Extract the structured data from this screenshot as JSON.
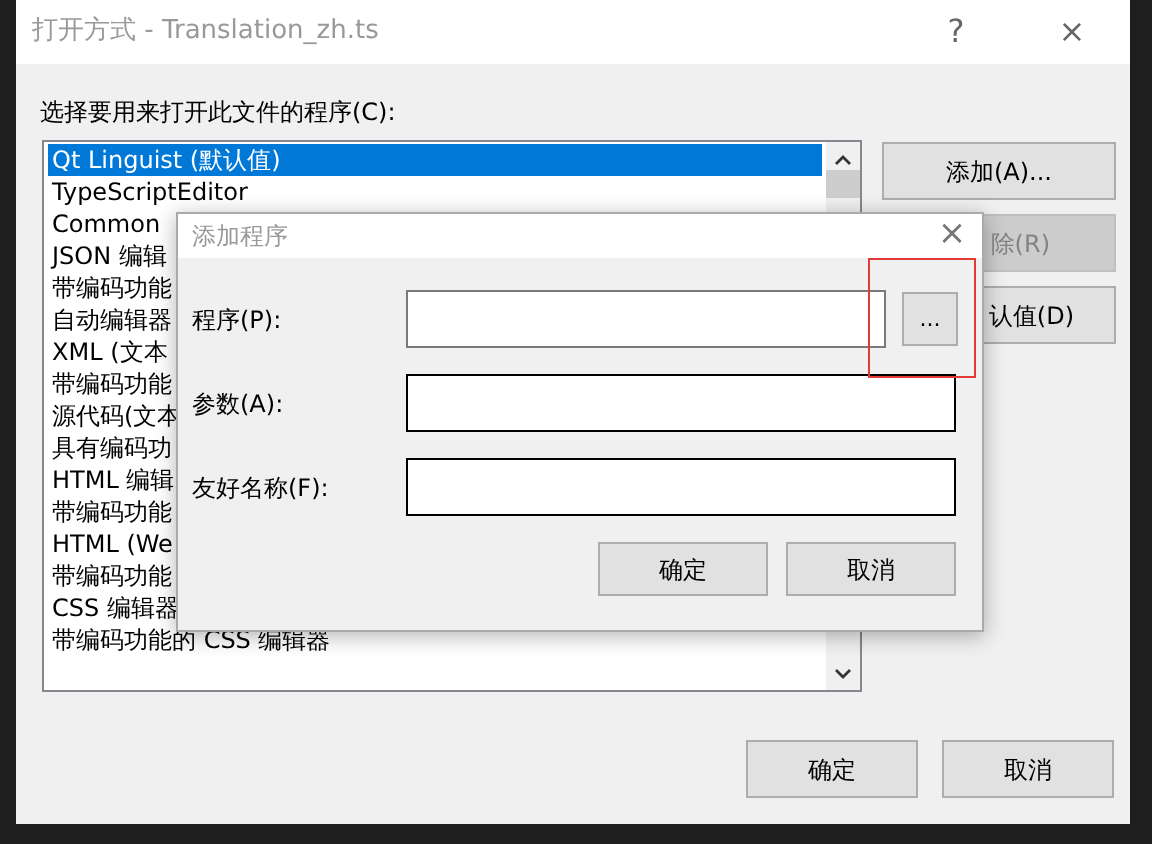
{
  "window": {
    "title": "打开方式 - Translation_zh.ts",
    "help": "?",
    "close": "×"
  },
  "prompt": "选择要用来打开此文件的程序(C):",
  "programs": [
    {
      "label": "Qt Linguist (默认值)",
      "selected": true
    },
    {
      "label": "TypeScriptEditor",
      "selected": false
    },
    {
      "label": "Common",
      "selected": false
    },
    {
      "label": "JSON 编辑",
      "selected": false
    },
    {
      "label": "带编码功能",
      "selected": false
    },
    {
      "label": "自动编辑器",
      "selected": false
    },
    {
      "label": "XML (文本",
      "selected": false
    },
    {
      "label": "带编码功能",
      "selected": false
    },
    {
      "label": "源代码(文本",
      "selected": false
    },
    {
      "label": "具有编码功",
      "selected": false
    },
    {
      "label": "HTML 编辑",
      "selected": false
    },
    {
      "label": "带编码功能",
      "selected": false
    },
    {
      "label": "HTML (We",
      "selected": false
    },
    {
      "label": "带编码功能",
      "selected": false
    },
    {
      "label": "CSS 编辑器",
      "selected": false
    },
    {
      "label": "带编码功能的 CSS 编辑器",
      "selected": false
    }
  ],
  "side_buttons": [
    {
      "label": "添加(A)...",
      "disabled": false
    },
    {
      "label": "除(R)",
      "disabled": true
    },
    {
      "label": "认值(D)",
      "disabled": false
    }
  ],
  "footer_buttons": [
    "确定",
    "取消"
  ],
  "add_dialog": {
    "title": "添加程序",
    "close": "×",
    "fields": [
      {
        "kind": "browse",
        "label": "程序(P):",
        "browse": "..."
      },
      {
        "kind": "text",
        "label": "参数(A):"
      },
      {
        "kind": "text",
        "label": "友好名称(F):"
      }
    ],
    "buttons": [
      "确定",
      "取消"
    ]
  }
}
